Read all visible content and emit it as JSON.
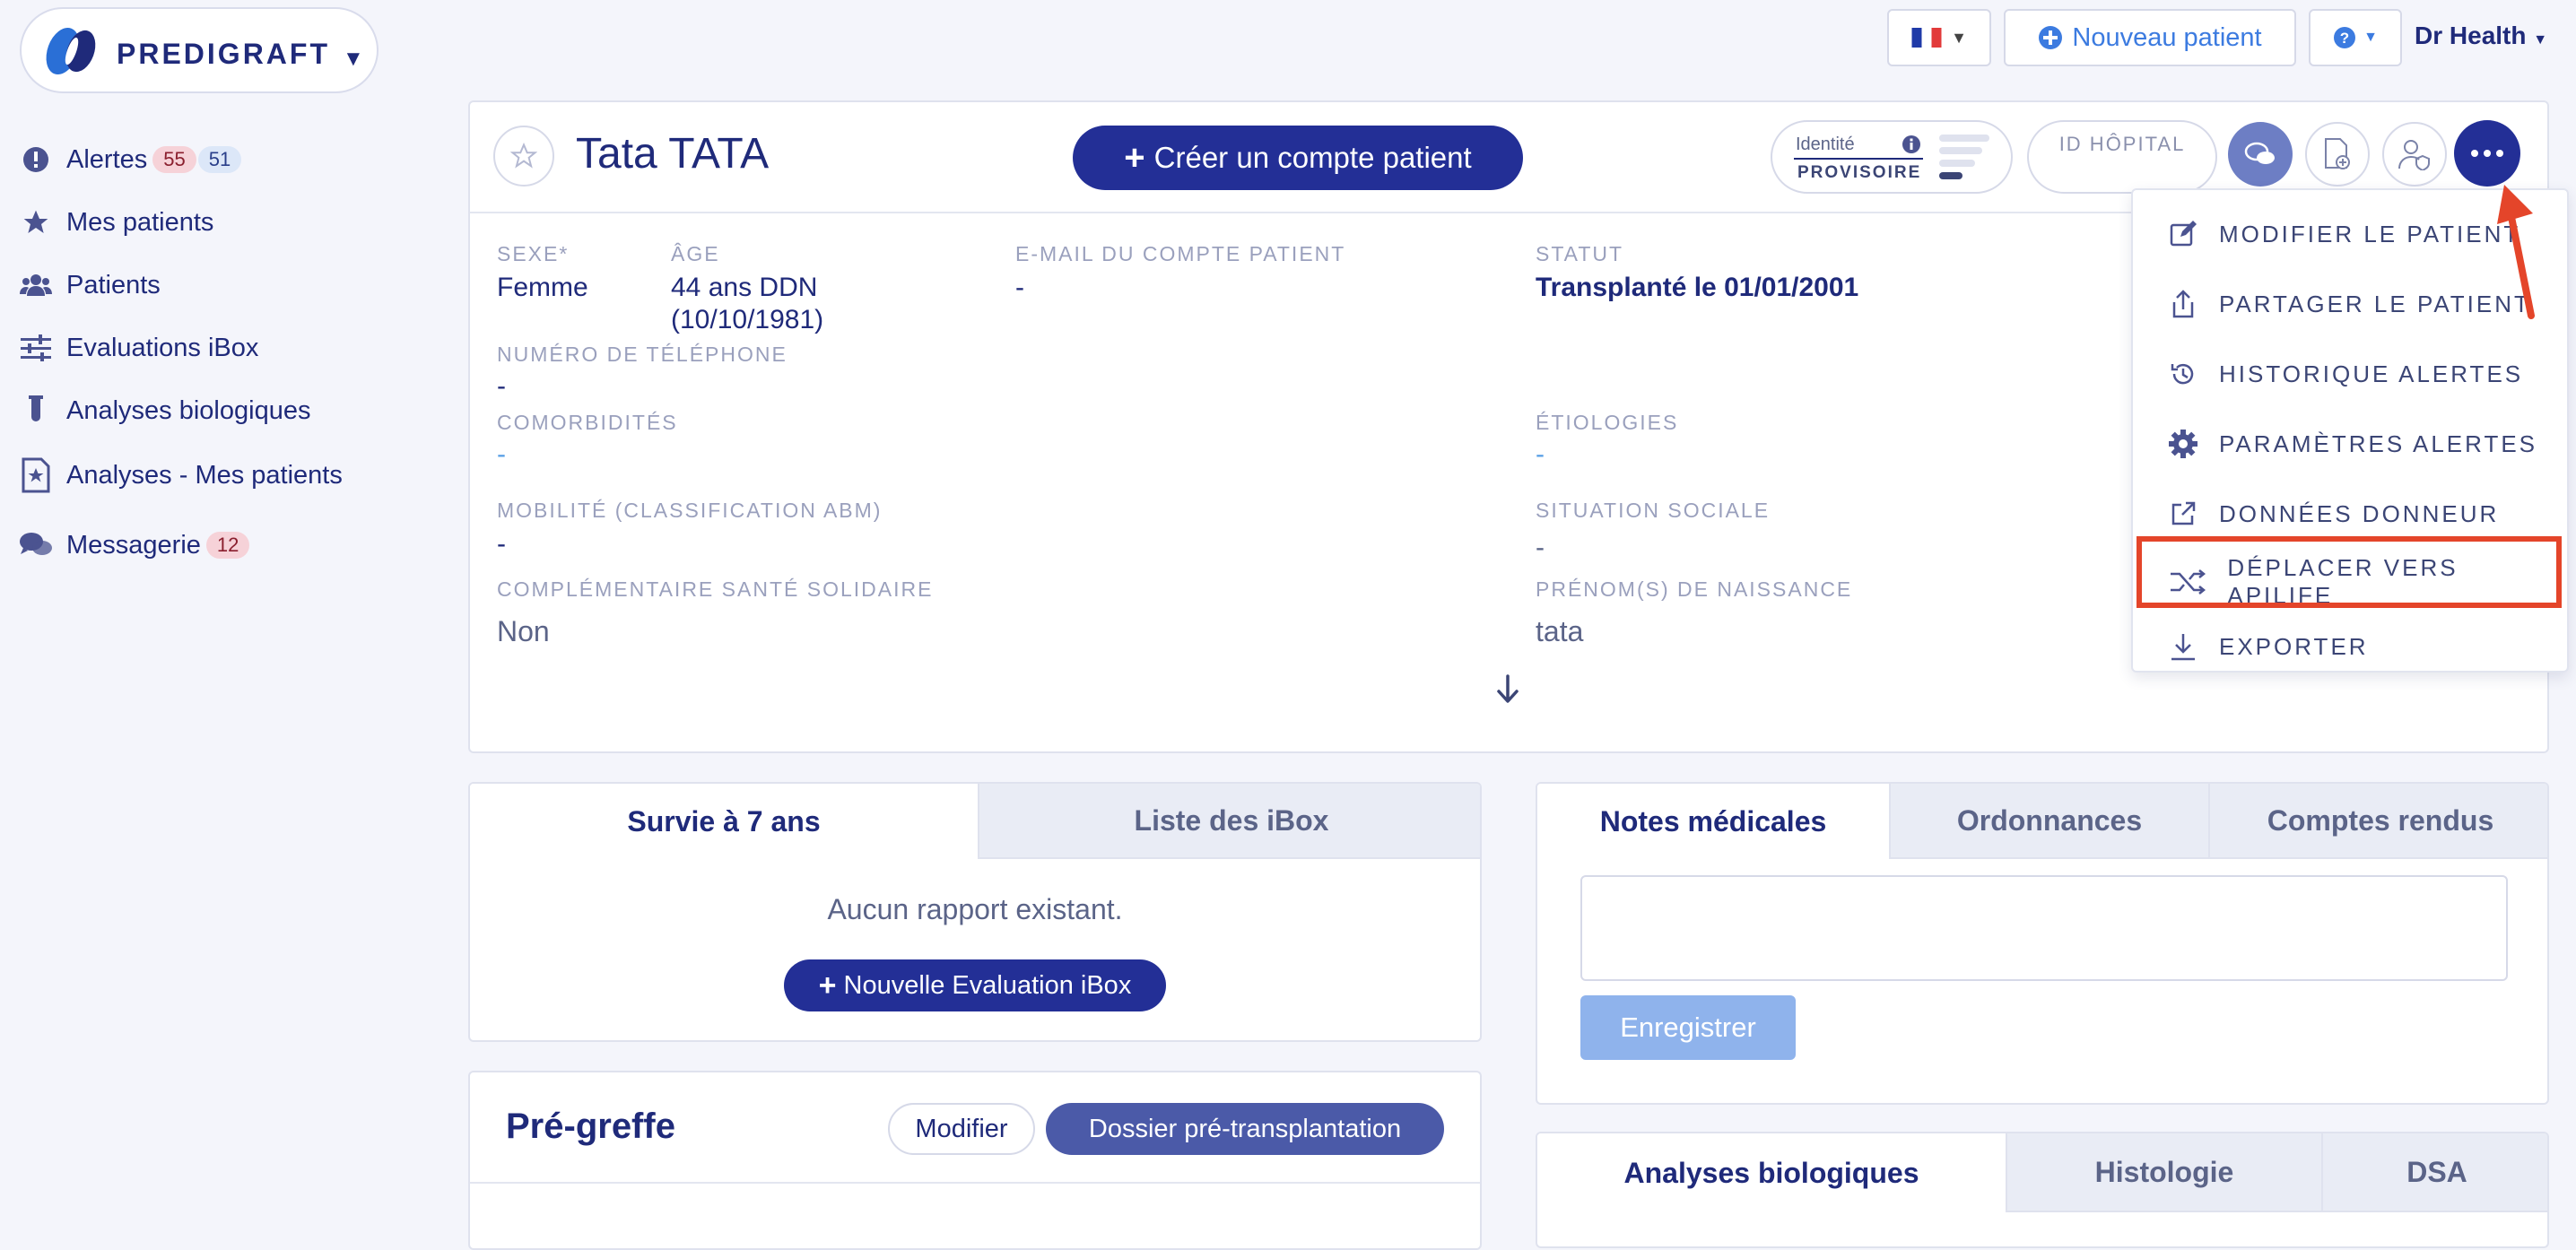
{
  "app": {
    "brand": "PREDIGRAFT"
  },
  "topbar": {
    "lang_flag": "fr-flag",
    "new_patient": "Nouveau patient",
    "help_icon": "question-icon",
    "user": "Dr Health"
  },
  "sidebar": {
    "items": [
      {
        "label": "Alertes",
        "badge_red": "55",
        "badge_blue": "51",
        "icon": "alert-icon"
      },
      {
        "label": "Mes patients",
        "icon": "star-icon"
      },
      {
        "label": "Patients",
        "icon": "users-icon"
      },
      {
        "label": "Evaluations iBox",
        "icon": "sliders-icon"
      },
      {
        "label": "Analyses biologiques",
        "icon": "test-tube-icon"
      },
      {
        "label": "Analyses - Mes patients",
        "icon": "document-star-icon"
      },
      {
        "label": "Messagerie",
        "badge_red": "12",
        "icon": "chat-icon"
      }
    ]
  },
  "patient": {
    "name": "Tata TATA",
    "create_account": "Créer un compte patient",
    "identity_label": "Identité",
    "identity_status": "PROVISOIRE",
    "hospital_id": "ID HÔPITAL",
    "fields": {
      "sexe_label": "SEXE*",
      "sexe_value": "Femme",
      "age_label": "ÂGE",
      "age_value_1": "44 ans DDN",
      "age_value_2": "(10/10/1981)",
      "email_label": "E-MAIL DU COMPTE PATIENT",
      "email_value": "-",
      "statut_label": "STATUT",
      "statut_value": "Transplanté le 01/01/2001",
      "phone_label": "NUMÉRO DE TÉLÉPHONE",
      "phone_value": "-",
      "comorb_label": "COMORBIDITÉS",
      "comorb_value": "-",
      "etio_label": "ÉTIOLOGIES",
      "etio_value": "-",
      "mobility_label": "MOBILITÉ (CLASSIFICATION ABM)",
      "mobility_value": "-",
      "social_label": "SITUATION SOCIALE",
      "social_value": "-",
      "css_label": "COMPLÉMENTAIRE SANTÉ SOLIDAIRE",
      "css_value": "Non",
      "birthname_label": "PRÉNOM(S) DE NAISSANCE",
      "birthname_value": "tata"
    }
  },
  "menu": {
    "items": [
      {
        "label": "MODIFIER LE PATIENT",
        "icon": "edit-icon"
      },
      {
        "label": "PARTAGER LE PATIENT",
        "icon": "share-icon"
      },
      {
        "label": "HISTORIQUE ALERTES",
        "icon": "history-icon"
      },
      {
        "label": "PARAMÈTRES ALERTES",
        "icon": "gear-icon"
      },
      {
        "label": "DONNÉES DONNEUR",
        "icon": "external-link-icon"
      },
      {
        "label": "DÉPLACER VERS APILIFE",
        "icon": "shuffle-icon"
      },
      {
        "label": "EXPORTER",
        "icon": "download-icon"
      }
    ]
  },
  "ibox": {
    "tab_survival": "Survie à 7 ans",
    "tab_list": "Liste des iBox",
    "empty": "Aucun rapport existant.",
    "new_eval": "Nouvelle Evaluation iBox"
  },
  "pregreffe": {
    "title": "Pré-greffe",
    "edit": "Modifier",
    "dossier": "Dossier pré-transplantation"
  },
  "notes": {
    "tab_notes": "Notes médicales",
    "tab_ord": "Ordonnances",
    "tab_cr": "Comptes rendus",
    "save": "Enregistrer"
  },
  "analyses": {
    "tab_bio": "Analyses biologiques",
    "tab_histo": "Histologie",
    "tab_dsa": "DSA"
  },
  "colors": {
    "primary": "#232f96",
    "accent_red": "#e4452a",
    "save_btn": "#8fb3ec"
  }
}
